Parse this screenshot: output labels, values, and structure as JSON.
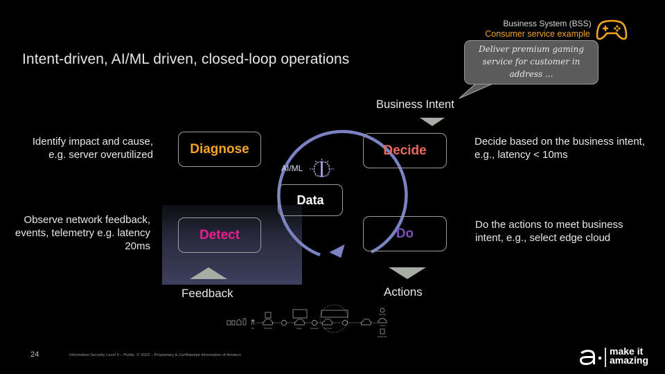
{
  "slide": {
    "title": "Intent-driven, AI/ML driven, closed-loop operations",
    "page_number": "24",
    "footer": "Information Security Level 0 – Public, © 2023 – Proprietary & Confidential Information of Amdocs"
  },
  "bss": {
    "title": "Business System (BSS)",
    "subtitle": "Consumer service example",
    "icon": "gamepad-icon",
    "speech_bubble": "Deliver premium gaming service for customer in address ..."
  },
  "loop": {
    "business_intent_label": "Business Intent",
    "feedback_label": "Feedback",
    "actions_label": "Actions",
    "aiml_label": "AI/ML",
    "aiml_icon": "brain-icon",
    "center_label": "Data",
    "stages": {
      "diagnose": {
        "label": "Diagnose",
        "color": "#f5a623",
        "description": "Identify impact and cause, e.g. server overutilized"
      },
      "decide": {
        "label": "Decide",
        "color": "#ee6a5b",
        "description": "Decide based on the business intent, e.g., latency < 10ms"
      },
      "detect": {
        "label": "Detect",
        "color": "#ee1d8f",
        "description": "Observe network feedback, events, telemetry e.g. latency 20ms"
      },
      "do": {
        "label": "Do",
        "color": "#7c4fb8",
        "description": "Do the actions to meet business intent, e.g., select edge cloud"
      }
    },
    "arrow_color": "#7b83c4"
  },
  "network": {
    "nodes": [
      "5G",
      "5G RAN",
      "Edge",
      "Transport",
      "5G Core",
      "Internet",
      "Cloud",
      "Enterprise"
    ]
  },
  "brand": {
    "logo": "amdocs-logo",
    "tagline_line1": "make it",
    "tagline_line2": "amazing"
  }
}
